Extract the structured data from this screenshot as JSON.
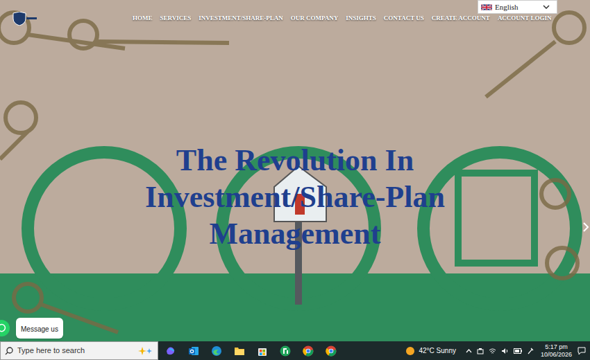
{
  "language": {
    "label": "English"
  },
  "nav": [
    {
      "label": "HOME"
    },
    {
      "label": "SERVICES"
    },
    {
      "label": "INVESTMENT/SHARE-PLAN"
    },
    {
      "label": "OUR COMPANY"
    },
    {
      "label": "INSIGHTS"
    },
    {
      "label": "CONTACT US"
    },
    {
      "label": "CREATE ACCOUNT"
    },
    {
      "label": "ACCOUNT LOGIN"
    }
  ],
  "hero": {
    "title_lines": [
      "The Revolution In",
      "Investment/Share-Plan",
      "Management"
    ]
  },
  "chat": {
    "label": "Message us"
  },
  "taskbar": {
    "search": {
      "placeholder": "Type here to search"
    },
    "weather": {
      "reading": "42°C Sunny"
    },
    "clock": {
      "time": "5:17 pm",
      "date": "10/06/2026"
    }
  }
}
